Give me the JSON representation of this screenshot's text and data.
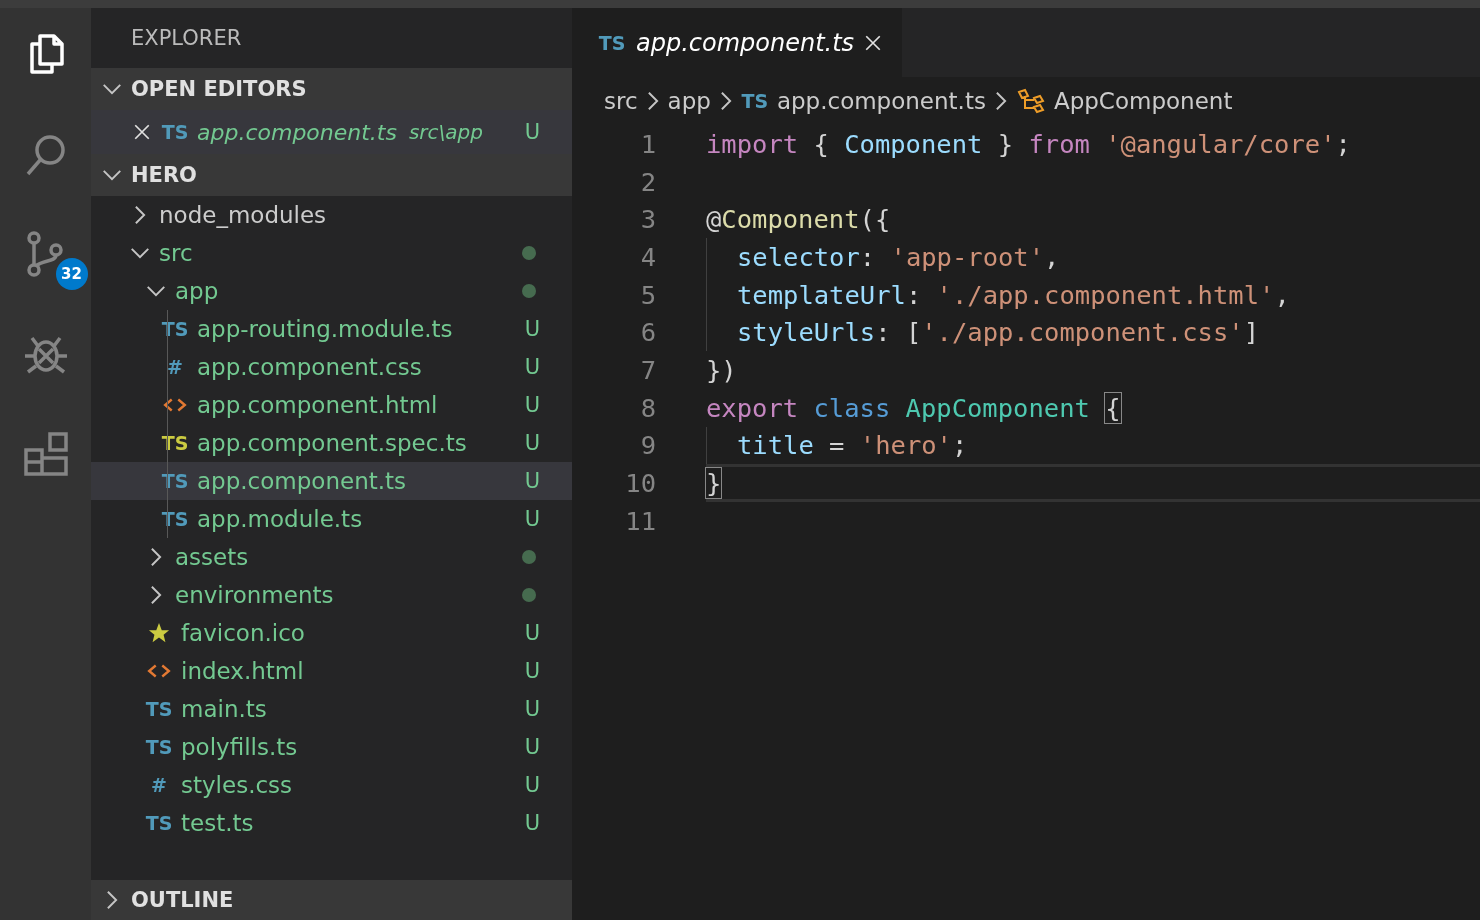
{
  "activity_bar": {
    "items": [
      {
        "kind": "explorer",
        "selected": true
      },
      {
        "kind": "search",
        "selected": false
      },
      {
        "kind": "source_control",
        "selected": false,
        "badge": "32"
      },
      {
        "kind": "debug",
        "selected": false
      },
      {
        "kind": "extensions",
        "selected": false
      }
    ]
  },
  "sidebar": {
    "title": "EXPLORER",
    "open_editors": {
      "header": "OPEN EDITORS",
      "expanded": true,
      "items": [
        {
          "kind": "ts",
          "icon_text": "TS",
          "name": "app.component.ts",
          "path": "src\\app",
          "status": "U",
          "preview": true
        }
      ]
    },
    "project": {
      "header": "HERO",
      "expanded": true,
      "tree": [
        {
          "kind": "folder",
          "name": "node_modules",
          "expanded": false,
          "selected": false
        },
        {
          "kind": "folder",
          "name": "src",
          "expanded": true,
          "modified": true,
          "selected": false,
          "children": [
            {
              "kind": "folder",
              "name": "app",
              "expanded": true,
              "modified": true,
              "selected": false,
              "children": [
                {
                  "kind": "ts",
                  "icon_text": "TS",
                  "name": "app-routing.module.ts",
                  "status": "U",
                  "selected": false
                },
                {
                  "kind": "css",
                  "icon_text": "#",
                  "name": "app.component.css",
                  "status": "U",
                  "selected": false
                },
                {
                  "kind": "html",
                  "name": "app.component.html",
                  "status": "U",
                  "selected": false
                },
                {
                  "kind": "spec",
                  "icon_text": "TS",
                  "name": "app.component.spec.ts",
                  "status": "U",
                  "selected": false
                },
                {
                  "kind": "ts",
                  "icon_text": "TS",
                  "name": "app.component.ts",
                  "status": "U",
                  "selected": true
                },
                {
                  "kind": "ts",
                  "icon_text": "TS",
                  "name": "app.module.ts",
                  "status": "U",
                  "selected": false
                }
              ]
            },
            {
              "kind": "folder",
              "name": "assets",
              "expanded": false,
              "modified": true,
              "selected": false
            },
            {
              "kind": "folder",
              "name": "environments",
              "expanded": false,
              "modified": true,
              "selected": false
            },
            {
              "kind": "star",
              "name": "favicon.ico",
              "status": "U",
              "selected": false
            },
            {
              "kind": "html",
              "name": "index.html",
              "status": "U",
              "selected": false
            },
            {
              "kind": "ts",
              "icon_text": "TS",
              "name": "main.ts",
              "status": "U",
              "selected": false
            },
            {
              "kind": "ts",
              "icon_text": "TS",
              "name": "polyfills.ts",
              "status": "U",
              "selected": false
            },
            {
              "kind": "css",
              "icon_text": "#",
              "name": "styles.css",
              "status": "U",
              "selected": false
            },
            {
              "kind": "ts",
              "icon_text": "TS",
              "name": "test.ts",
              "status": "U",
              "selected": false
            }
          ]
        }
      ]
    },
    "outline": {
      "header": "OUTLINE",
      "expanded": false
    }
  },
  "editor": {
    "tabs": [
      {
        "icon_text": "TS",
        "label": "app.component.ts",
        "selected": true,
        "preview": true
      }
    ],
    "breadcrumbs": [
      {
        "kind": "folder",
        "text": "src"
      },
      {
        "kind": "folder",
        "text": "app"
      },
      {
        "kind": "file",
        "icon_text": "TS",
        "text": "app.component.ts"
      },
      {
        "kind": "class",
        "text": "AppComponent"
      }
    ],
    "lines": [
      {
        "number": "1",
        "current": false,
        "guide": false,
        "tokens": [
          {
            "kind": "keyword",
            "text": "import"
          },
          {
            "kind": "plain",
            "text": " { "
          },
          {
            "kind": "variable",
            "text": "Component"
          },
          {
            "kind": "plain",
            "text": " } "
          },
          {
            "kind": "keyword",
            "text": "from"
          },
          {
            "kind": "string",
            "text": " '@angular/core'"
          },
          {
            "kind": "plain",
            "text": ";"
          }
        ]
      },
      {
        "number": "2",
        "current": false,
        "guide": false
      },
      {
        "number": "3",
        "current": false,
        "guide": false,
        "tokens": [
          {
            "kind": "plain",
            "text": "@"
          },
          {
            "kind": "function",
            "text": "Component"
          },
          {
            "kind": "plain",
            "text": "({"
          }
        ]
      },
      {
        "number": "4",
        "current": false,
        "guide": true,
        "tokens": [
          {
            "kind": "variable",
            "text": "selector"
          },
          {
            "kind": "plain",
            "text": ": "
          },
          {
            "kind": "string",
            "text": "'app-root'"
          },
          {
            "kind": "plain",
            "text": ","
          }
        ]
      },
      {
        "number": "5",
        "current": false,
        "guide": true,
        "tokens": [
          {
            "kind": "variable",
            "text": "templateUrl"
          },
          {
            "kind": "plain",
            "text": ": "
          },
          {
            "kind": "string",
            "text": "'./app.component.html'"
          },
          {
            "kind": "plain",
            "text": ","
          }
        ]
      },
      {
        "number": "6",
        "current": false,
        "guide": true,
        "tokens": [
          {
            "kind": "variable",
            "text": "styleUrls"
          },
          {
            "kind": "plain",
            "text": ": ["
          },
          {
            "kind": "string",
            "text": "'./app.component.css'"
          },
          {
            "kind": "plain",
            "text": "]"
          }
        ]
      },
      {
        "number": "7",
        "current": false,
        "guide": false,
        "tokens": [
          {
            "kind": "plain",
            "text": "})"
          }
        ]
      },
      {
        "number": "8",
        "current": false,
        "guide": false,
        "tokens": [
          {
            "kind": "keyword",
            "text": "export"
          },
          {
            "kind": "storage",
            "text": " class"
          },
          {
            "kind": "class",
            "text": " AppComponent "
          },
          {
            "kind": "plain",
            "text": "{",
            "matched": true
          }
        ]
      },
      {
        "number": "9",
        "current": false,
        "guide": true,
        "tokens": [
          {
            "kind": "variable",
            "text": "title"
          },
          {
            "kind": "plain",
            "text": " = "
          },
          {
            "kind": "string",
            "text": "'hero'"
          },
          {
            "kind": "plain",
            "text": ";"
          }
        ]
      },
      {
        "number": "10",
        "current": true,
        "guide": false,
        "tokens": [
          {
            "kind": "plain",
            "text": "}",
            "matched": true
          }
        ]
      },
      {
        "number": "11",
        "current": false,
        "guide": false
      }
    ]
  }
}
